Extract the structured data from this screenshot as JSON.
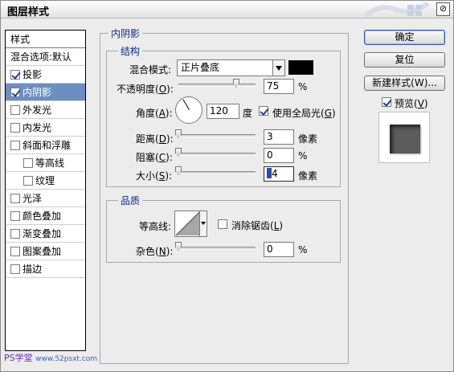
{
  "window": {
    "title": "图层样式",
    "close_glyph": "⊘"
  },
  "styles_list": {
    "header": "样式",
    "blend_options": "混合选项:默认",
    "items": [
      {
        "label": "投影",
        "checked": true
      },
      {
        "label": "内阴影",
        "checked": true,
        "selected": true
      },
      {
        "label": "外发光",
        "checked": false
      },
      {
        "label": "内发光",
        "checked": false
      },
      {
        "label": "斜面和浮雕",
        "checked": false
      },
      {
        "label": "等高线",
        "checked": false,
        "indent": true
      },
      {
        "label": "纹理",
        "checked": false,
        "indent": true
      },
      {
        "label": "光泽",
        "checked": false
      },
      {
        "label": "颜色叠加",
        "checked": false
      },
      {
        "label": "渐变叠加",
        "checked": false
      },
      {
        "label": "图案叠加",
        "checked": false
      },
      {
        "label": "描边",
        "checked": false
      }
    ]
  },
  "inner_shadow": {
    "section_title": "内阴影",
    "structure": {
      "title": "结构",
      "blend_mode_label": "混合模式:",
      "blend_mode_value": "正片叠底",
      "shadow_color": "#000000",
      "opacity": {
        "label": "不透明度",
        "key": "O",
        "value": "75",
        "unit": "%",
        "fraction": 0.75
      },
      "angle": {
        "label": "角度",
        "key": "A",
        "value": "120",
        "unit": "度",
        "degrees": 120
      },
      "global_light": {
        "label": "使用全局光",
        "key": "G",
        "checked": true
      },
      "distance": {
        "label": "距离",
        "key": "D",
        "value": "3",
        "unit": "像素",
        "fraction": 0.0
      },
      "choke": {
        "label": "阻塞",
        "key": "C",
        "value": "0",
        "unit": "%",
        "fraction": 0.0
      },
      "size": {
        "label": "大小",
        "key": "S",
        "value": "4",
        "unit": "像素",
        "fraction": 0.0
      }
    },
    "quality": {
      "title": "品质",
      "contour_label": "等高线:",
      "anti_alias": {
        "label": "消除锯齿",
        "key": "L",
        "checked": false
      },
      "noise": {
        "label": "杂色",
        "key": "N",
        "value": "0",
        "unit": "%",
        "fraction": 0.0
      }
    }
  },
  "buttons": {
    "ok": "确定",
    "reset": "复位",
    "new_style": "新建样式(W)...",
    "preview_label": "预览",
    "preview_key": "V",
    "preview_checked": true
  },
  "watermark": {
    "main": "PS学堂",
    "sub": "www.52psxt.com"
  }
}
